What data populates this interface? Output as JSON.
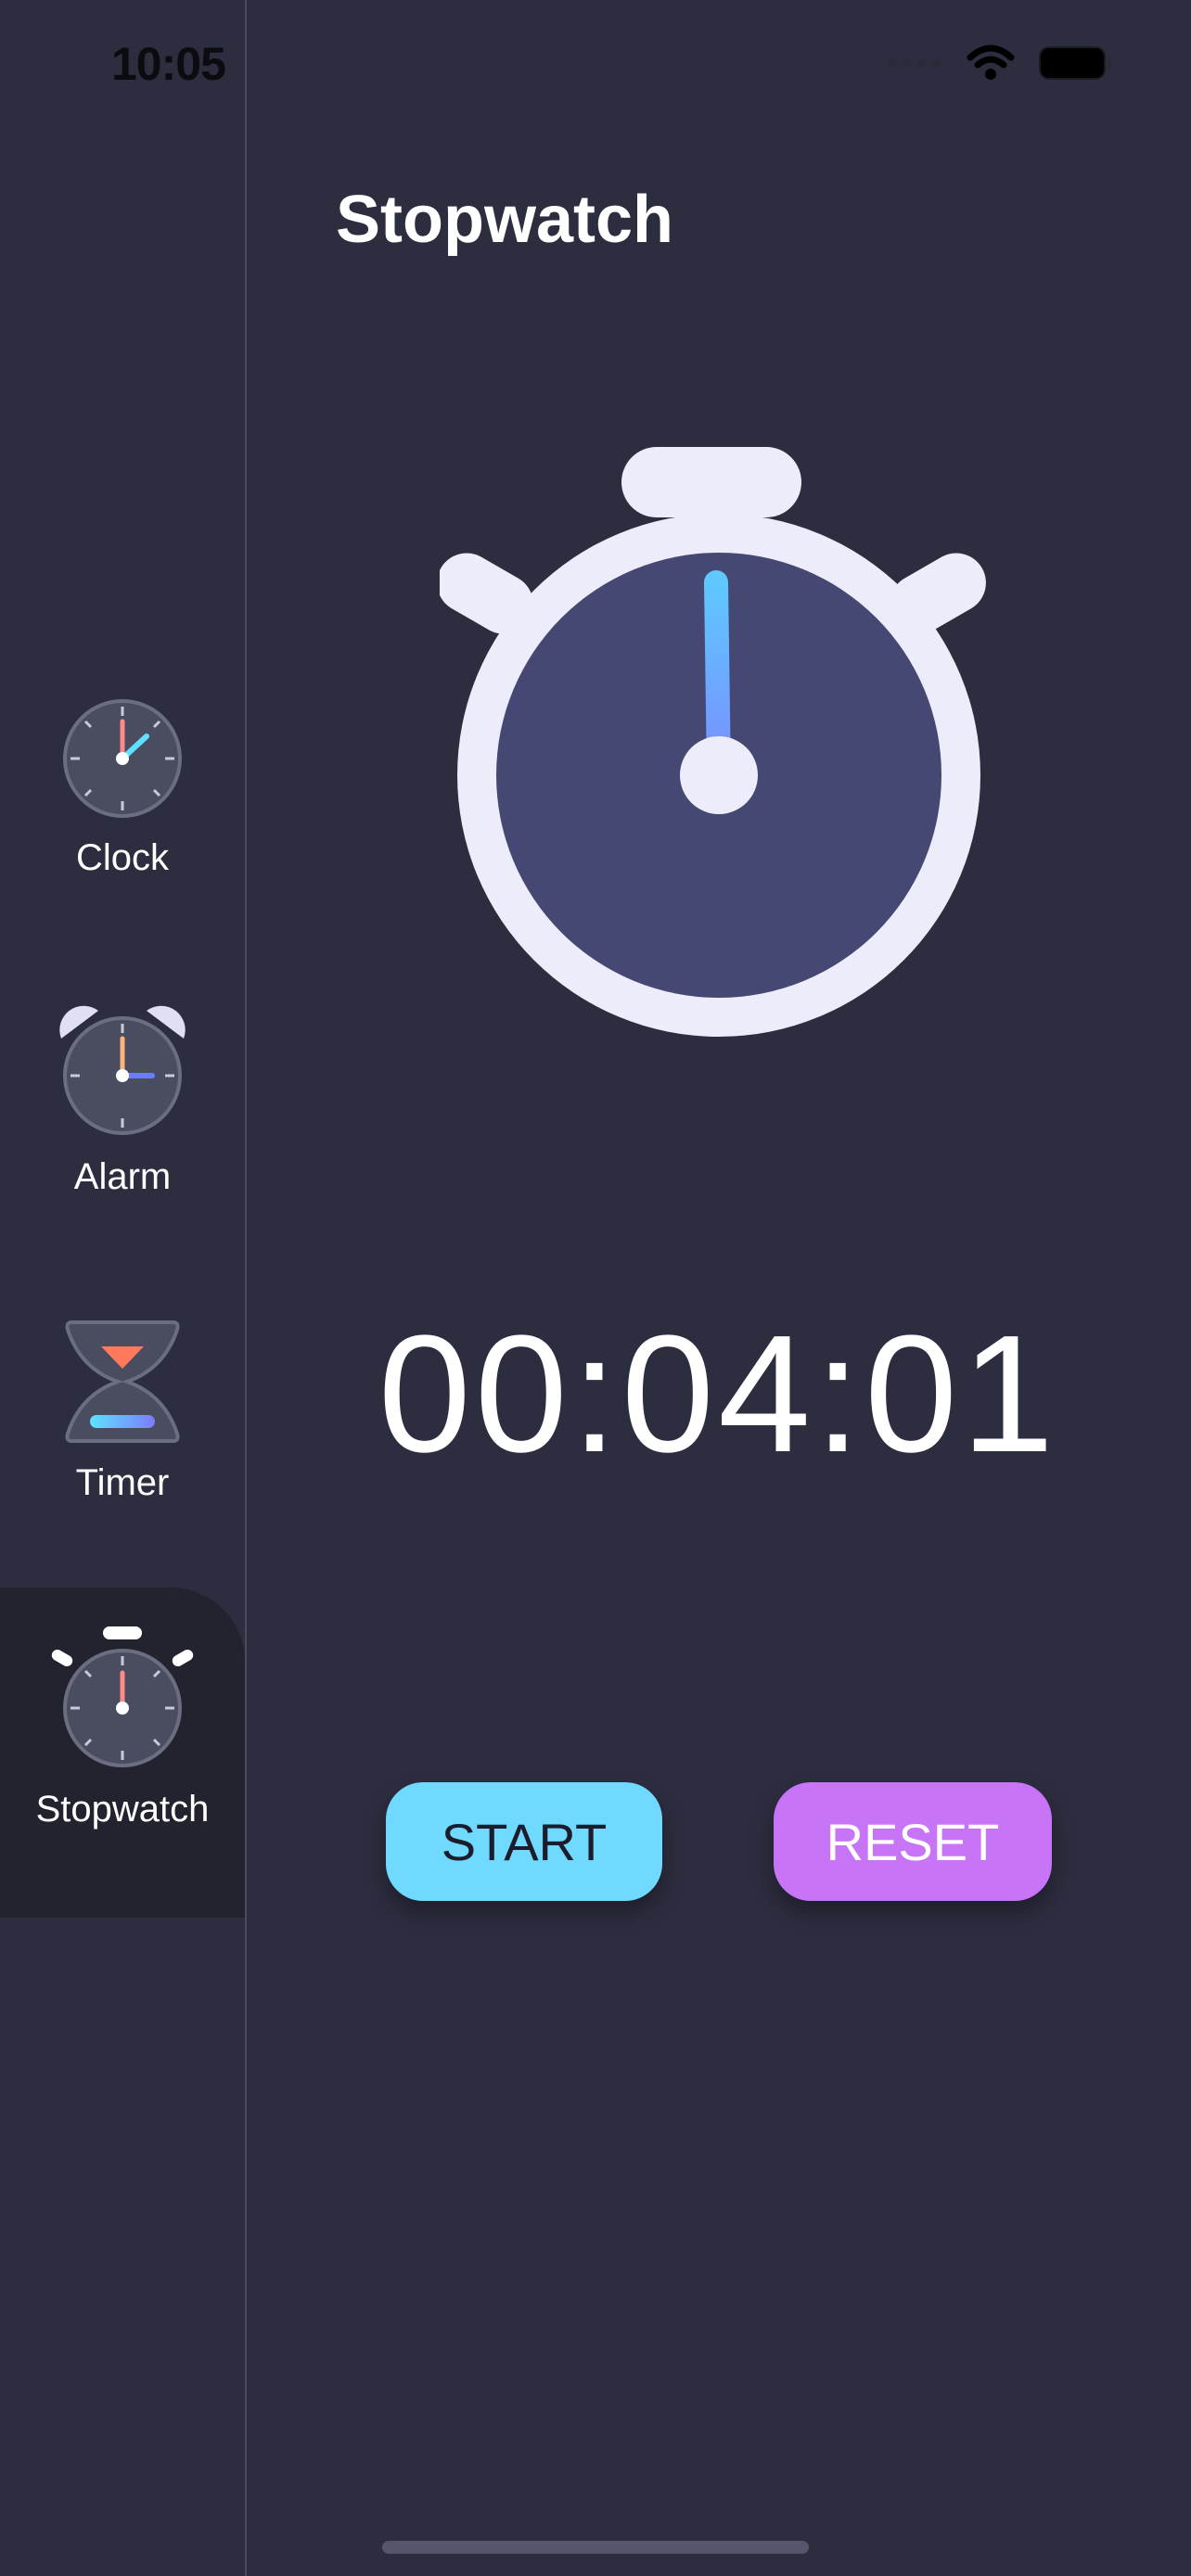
{
  "status_bar": {
    "time": "10:05",
    "icons": [
      "cellular-icon",
      "wifi-icon",
      "battery-icon"
    ]
  },
  "sidebar": {
    "items": [
      {
        "label": "Clock",
        "icon": "clock-icon",
        "active": false
      },
      {
        "label": "Alarm",
        "icon": "alarm-clock-icon",
        "active": false
      },
      {
        "label": "Timer",
        "icon": "hourglass-icon",
        "active": false
      },
      {
        "label": "Stopwatch",
        "icon": "stopwatch-icon",
        "active": true
      }
    ]
  },
  "main": {
    "title": "Stopwatch",
    "elapsed": "00:04:01",
    "graphic": "stopwatch-illustration",
    "buttons": {
      "start_label": "START",
      "reset_label": "RESET"
    }
  },
  "colors": {
    "background": "#2d2d40",
    "sidebar_active": "#23232f",
    "start_button": "#6fd9ff",
    "reset_button": "#c774f7",
    "watch_face": "#454873",
    "watch_frame": "#ececfb"
  }
}
